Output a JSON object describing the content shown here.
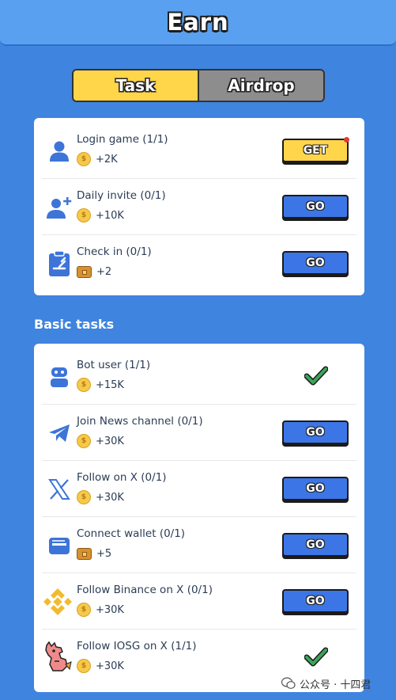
{
  "header": {
    "title": "Earn"
  },
  "tabs": [
    {
      "label": "Task",
      "active": true
    },
    {
      "label": "Airdrop",
      "active": false
    }
  ],
  "daily_tasks": [
    {
      "name": "Login game (1/1)",
      "reward": "+2K",
      "reward_icon": "coin-icon",
      "icon": "user-icon",
      "action": "GET",
      "action_dot": true
    },
    {
      "name": "Daily invite (0/1)",
      "reward": "+10K",
      "reward_icon": "coin-icon",
      "icon": "add-user-icon",
      "action": "GO"
    },
    {
      "name": "Check in (0/1)",
      "reward": "+2",
      "reward_icon": "chest-icon",
      "icon": "clipboard-icon",
      "action": "GO"
    }
  ],
  "basic_section": {
    "title": "Basic tasks"
  },
  "basic_tasks": [
    {
      "name": "Bot user (1/1)",
      "reward": "+15K",
      "reward_icon": "coin-icon",
      "icon": "bot-icon",
      "action": "done"
    },
    {
      "name": "Join News channel (0/1)",
      "reward": "+30K",
      "reward_icon": "coin-icon",
      "icon": "telegram-icon",
      "action": "GO"
    },
    {
      "name": "Follow on X (0/1)",
      "reward": "+30K",
      "reward_icon": "coin-icon",
      "icon": "x-logo-icon",
      "action": "GO"
    },
    {
      "name": "Connect wallet (0/1)",
      "reward": "+5",
      "reward_icon": "chest-icon",
      "icon": "wallet-icon",
      "action": "GO"
    },
    {
      "name": "Follow Binance on X (0/1)",
      "reward": "+30K",
      "reward_icon": "coin-icon",
      "icon": "binance-icon",
      "action": "GO"
    },
    {
      "name": "Follow IOSG on X (1/1)",
      "reward": "+30K",
      "reward_icon": "coin-icon",
      "icon": "iosg-dragon-icon",
      "action": "done"
    }
  ],
  "watermark": {
    "text": "公众号 · 十四君"
  },
  "colors": {
    "background": "#3f84df",
    "header": "#5aa0f0",
    "active_tab": "#ffd54a",
    "inactive_tab": "#8d8d8d",
    "go_button": "#3c76e6",
    "get_button": "#ffd54a",
    "check": "#3aa55a",
    "icon_blue": "#3d74d8"
  }
}
